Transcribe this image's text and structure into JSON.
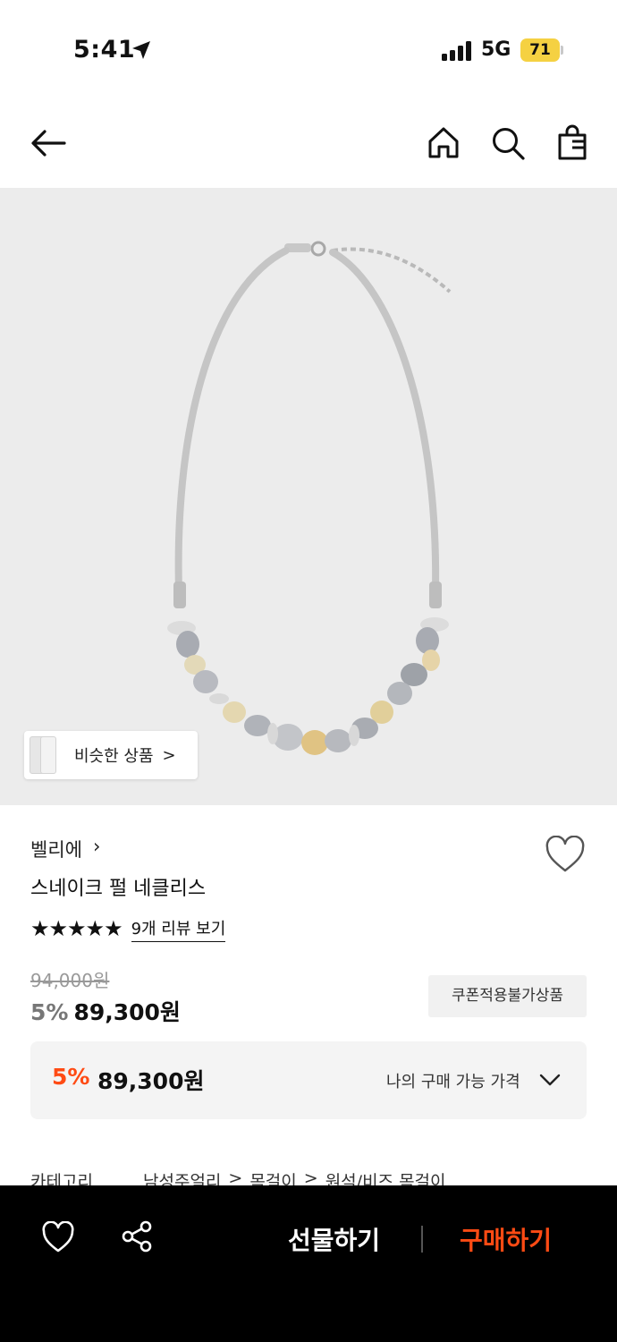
{
  "status_bar": {
    "time": "5:41",
    "network": "5G",
    "battery": "71",
    "battery_color": "#f5d142"
  },
  "header": {
    "icons": [
      "back-arrow-icon",
      "home-icon",
      "search-icon",
      "shopping-bag-icon"
    ]
  },
  "product": {
    "similar_label": "비슷한 상품",
    "brand": "벨리에",
    "name": "스네이크 펄 네클리스",
    "rating_stars": "★★★★★",
    "rating_value": 5,
    "review_link": "9개 리뷰 보기",
    "original_price": "94,000원",
    "discount": "5%",
    "sale_price": "89,300원",
    "coupon_badge": "쿠폰적용불가상품"
  },
  "my_price": {
    "discount": "5%",
    "price": "89,300원",
    "label": "나의 구매 가능 가격",
    "accent_color": "#ff4b14"
  },
  "category": {
    "label": "카테고리",
    "path": [
      "남성주얼리",
      "목걸이",
      "원석/비즈 목걸이"
    ],
    "separator": ">"
  },
  "bottom_bar": {
    "gift_label": "선물하기",
    "buy_label": "구매하기",
    "buy_color": "#ff4b14"
  }
}
